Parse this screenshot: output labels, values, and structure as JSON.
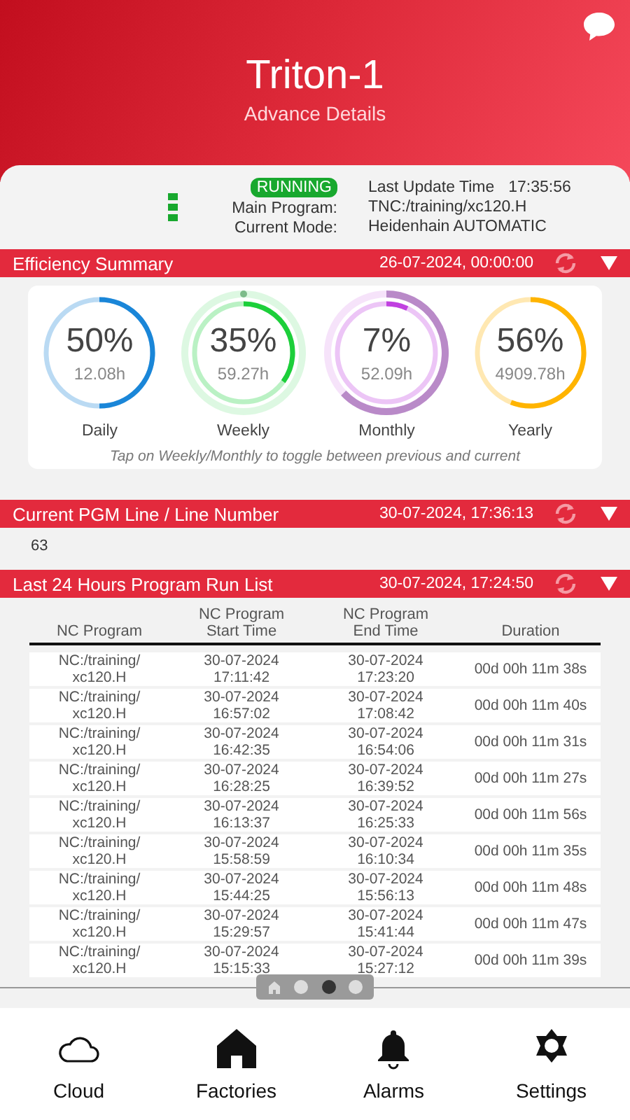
{
  "header": {
    "title": "Triton-1",
    "subtitle": "Advance Details"
  },
  "machine": {
    "status": "RUNNING",
    "running": true,
    "fields": [
      {
        "label": "Last Update Time",
        "value": "17:35:56"
      },
      {
        "label": "Main Program:",
        "value": "TNC:/training/xc120.H"
      },
      {
        "label": "Current Mode:",
        "value": "Heidenhain AUTOMATIC"
      }
    ]
  },
  "efficiency": {
    "title": "Efficiency Summary",
    "timestamp": "26-07-2024, 00:00:00",
    "expanded": true,
    "gauges": [
      {
        "kind": "single",
        "percent": "50%",
        "hours": "12.08h",
        "label": "Daily",
        "color": "#1a86d8"
      },
      {
        "kind": "dot_ring",
        "percent": "35%",
        "hours": "59.27h",
        "label": "Weekly",
        "color": "#1ccf3a"
      },
      {
        "kind": "arc_ring",
        "percent": "7%",
        "hours": "52.09h",
        "label": "Monthly",
        "color": "#c040e0"
      },
      {
        "kind": "single",
        "percent": "56%",
        "hours": "4909.78h",
        "label": "Yearly",
        "color": "#ffb400"
      }
    ],
    "hint": "Tap on Weekly/Monthly to toggle between previous and current"
  },
  "pgm_line": {
    "title": "Current PGM Line / Line Number",
    "timestamp": "30-07-2024, 17:36:13",
    "expanded": true,
    "value": "63"
  },
  "run_list": {
    "title": "Last 24 Hours Program Run List",
    "timestamp": "30-07-2024, 17:24:50",
    "expanded": true,
    "columns": [
      "NC Program",
      "NC Program\nStart Time",
      "NC Program\nEnd Time",
      "Duration"
    ],
    "rows": [
      [
        "NC:/training/\nxc120.H",
        "30-07-2024\n17:11:42",
        "30-07-2024\n17:23:20",
        "00d 00h 11m 38s"
      ],
      [
        "NC:/training/\nxc120.H",
        "30-07-2024\n16:57:02",
        "30-07-2024\n17:08:42",
        "00d 00h 11m 40s"
      ],
      [
        "NC:/training/\nxc120.H",
        "30-07-2024\n16:42:35",
        "30-07-2024\n16:54:06",
        "00d 00h 11m 31s"
      ],
      [
        "NC:/training/\nxc120.H",
        "30-07-2024\n16:28:25",
        "30-07-2024\n16:39:52",
        "00d 00h 11m 27s"
      ],
      [
        "NC:/training/\nxc120.H",
        "30-07-2024\n16:13:37",
        "30-07-2024\n16:25:33",
        "00d 00h 11m 56s"
      ],
      [
        "NC:/training/\nxc120.H",
        "30-07-2024\n15:58:59",
        "30-07-2024\n16:10:34",
        "00d 00h 11m 35s"
      ],
      [
        "NC:/training/\nxc120.H",
        "30-07-2024\n15:44:25",
        "30-07-2024\n15:56:13",
        "00d 00h 11m 48s"
      ],
      [
        "NC:/training/\nxc120.H",
        "30-07-2024\n15:29:57",
        "30-07-2024\n15:41:44",
        "00d 00h 11m 47s"
      ],
      [
        "NC:/training/\nxc120.H",
        "30-07-2024\n15:15:33",
        "30-07-2024\n15:27:12",
        "00d 00h 11m 39s"
      ]
    ]
  },
  "pager": [
    {
      "kind": "home",
      "selected": false
    },
    {
      "kind": "dot",
      "selected": false
    },
    {
      "kind": "dot",
      "selected": true
    },
    {
      "kind": "dot",
      "selected": false
    }
  ],
  "nav": [
    {
      "kind": "cloud",
      "label": "Cloud"
    },
    {
      "kind": "home",
      "label": "Factories"
    },
    {
      "kind": "bell",
      "label": "Alarms"
    },
    {
      "kind": "gear",
      "label": "Settings"
    }
  ]
}
